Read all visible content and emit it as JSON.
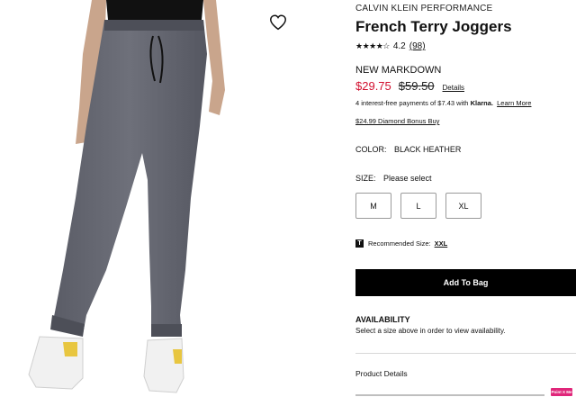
{
  "product": {
    "brand": "CALVIN KLEIN PERFORMANCE",
    "title": "French Terry Joggers",
    "stars": "★★★★☆",
    "rating": "4.2",
    "review_count": "(98)",
    "markdown_label": "NEW MARKDOWN",
    "sale_price": "$29.75",
    "original_price": "$59.50",
    "details_link": "Details",
    "klarna_text": "4 interest-free payments of $7.43 with",
    "klarna_brand": "Klarna.",
    "klarna_learn_more": "Learn More",
    "bonus_buy": "$24.99 Diamond Bonus Buy",
    "color_label": "COLOR:",
    "color_value": "BLACK HEATHER",
    "size_label": "SIZE:",
    "size_value": "Please select",
    "sizes": [
      "M",
      "L",
      "XL"
    ],
    "recommended_icon": "T",
    "recommended_label": "Recommended Size:",
    "recommended_size": "XXL",
    "add_to_bag": "Add To Bag",
    "availability_title": "AVAILABILITY",
    "availability_msg": "Select a size above in order to view availability.",
    "product_details_label": "Product Details"
  },
  "badge": {
    "text": "Point X Me"
  },
  "colors": {
    "sale": "#d2102f",
    "button_bg": "#000000",
    "badge": "#e0267a"
  },
  "icons": {
    "wishlist": "heart-outline-icon",
    "recommended": "brand-t-icon"
  }
}
